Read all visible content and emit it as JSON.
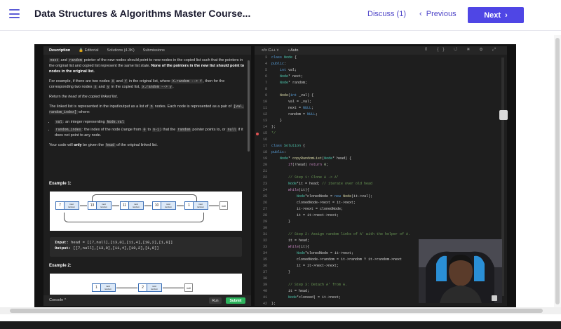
{
  "header": {
    "course_title": "Data Structures & Algorithms Master Course...",
    "discuss_label": "Discuss (1)",
    "previous_label": "Previous",
    "next_label": "Next"
  },
  "problem_tabs": [
    "Description",
    "Editorial",
    "Solutions (4.3K)",
    "Submissions"
  ],
  "description": {
    "p1_a": "next",
    "p1_b": " and ",
    "p1_c": "random",
    "p1_d": " pointer of the new nodes should point to new nodes in the copied list such that the pointers in the original list and copied list represent the same list state. ",
    "p1_bold": "None of the pointers in the new list should point to nodes in the original list.",
    "p2_a": "For example, if there are two nodes ",
    "p2_X": "X",
    "p2_b": " and ",
    "p2_Y": "Y",
    "p2_c": " in the original list, where ",
    "p2_code1": "X.random --> Y",
    "p2_d": ", then for the corresponding two nodes ",
    "p2_x": "x",
    "p2_e": " and ",
    "p2_y": "y",
    "p2_f": " in the copied list, ",
    "p2_code2": "x.random --> y",
    "p2_g": ".",
    "p3_a": "Return ",
    "p3_i": "the head of the copied linked list",
    "p3_b": ".",
    "p4_a": "The linked list is represented in the input/output as a list of ",
    "p4_n": "n",
    "p4_b": " nodes. Each node is represented as a pair of ",
    "p4_code": "[val, random_index]",
    "p4_c": " where:",
    "li1_code": "val",
    "li1_text": ": an integer representing ",
    "li1_code2": "Node.val",
    "li2_code": "random_index",
    "li2_text": ": the index of the node (range from ",
    "li2_0": "0",
    "li2_to": " to ",
    "li2_n1": "n-1",
    "li2_text2": ") that the ",
    "li2_random": "random",
    "li2_text3": " pointer points to, or ",
    "li2_null": "null",
    "li2_text4": " if it does not point to any node.",
    "p5_a": "Your code will ",
    "p5_b": "only",
    "p5_c": " be given the ",
    "p5_head": "head",
    "p5_d": " of the original linked list."
  },
  "example1": {
    "title": "Example 1:",
    "node_values": [
      "7",
      "13",
      "11",
      "10",
      "1"
    ],
    "node_next_label": "next",
    "node_random_label": "random",
    "null_label": "null",
    "input_label": "Input:",
    "input_value": "head = [[7,null],[13,0],[11,4],[10,2],[1,0]]",
    "output_label": "Output:",
    "output_value": "[[7,null],[13,0],[11,4],[10,2],[1,0]]"
  },
  "example2": {
    "title": "Example 2:",
    "node_values": [
      "1",
      "2"
    ],
    "null_label": "null"
  },
  "console": {
    "label": "Console ^",
    "run_label": "Run",
    "submit_label": "Submit"
  },
  "editor": {
    "language": "C++",
    "mode": "Auto",
    "icons": "⌷ {} ↺ ⌘ ⚙ ⤢",
    "line_numbers": [
      "3",
      "4",
      "5",
      "6",
      "7",
      "8",
      "9",
      "10",
      "11",
      "12",
      "13",
      "14",
      "15",
      "16",
      "17",
      "18",
      "19",
      "20",
      "21",
      "22",
      "23",
      "24",
      "25",
      "26",
      "27",
      "28",
      "29",
      "30",
      "31",
      "32",
      "33",
      "34",
      "35",
      "36",
      "37",
      "38",
      "39",
      "40",
      "41",
      "42",
      "43"
    ],
    "breakpoint_line": "15"
  },
  "colors": {
    "accent": "#4f46e5",
    "submit": "#2db55d",
    "breakpoint": "#e05252"
  }
}
